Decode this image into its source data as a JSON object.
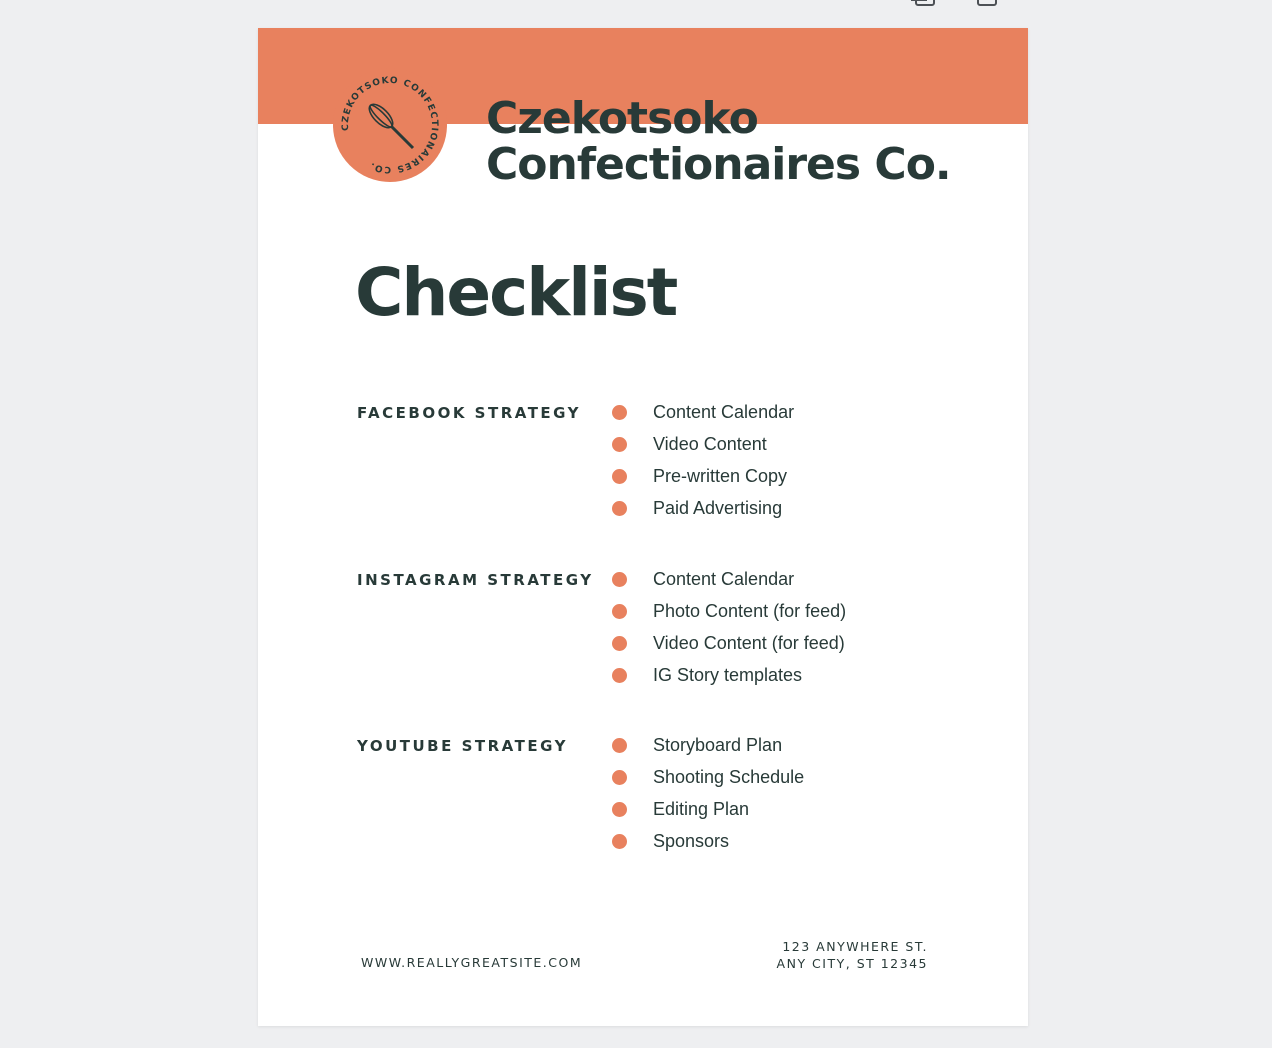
{
  "toolbar": {
    "icons": [
      "duplicate-page-icon",
      "add-page-icon"
    ]
  },
  "colors": {
    "accent": "#e8815e",
    "text": "#283a38",
    "background": "#eeeff1",
    "page": "#ffffff"
  },
  "document": {
    "logo": {
      "ring_text": "CZEKOTSOKO CONFECTIONAIRES CO.",
      "icon": "whisk-icon"
    },
    "company_name": {
      "line1": "Czekotsoko",
      "line2": "Confectionaires Co."
    },
    "title": "Checklist",
    "sections": [
      {
        "label": "FACEBOOK STRATEGY",
        "items": [
          "Content Calendar",
          "Video Content",
          "Pre-written Copy",
          "Paid Advertising"
        ]
      },
      {
        "label": "INSTAGRAM STRATEGY",
        "items": [
          "Content Calendar",
          "Photo Content (for feed)",
          "Video Content (for feed)",
          "IG Story templates"
        ]
      },
      {
        "label": "YOUTUBE STRATEGY",
        "items": [
          "Storyboard Plan",
          "Shooting Schedule",
          "Editing Plan",
          "Sponsors"
        ]
      }
    ],
    "footer": {
      "website": "WWW.REALLYGREATSITE.COM",
      "address_line1": "123 ANYWHERE ST.",
      "address_line2": "ANY CITY, ST 12345"
    }
  }
}
